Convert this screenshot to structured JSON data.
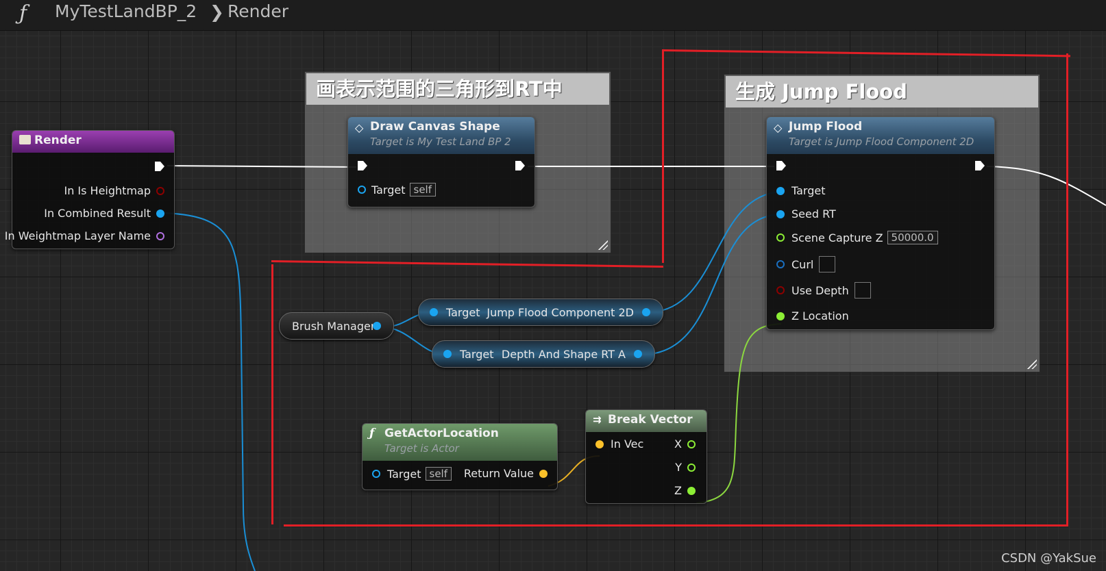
{
  "breadcrumb": {
    "function_icon": "ƒ",
    "blueprint": "MyTestLandBP_2",
    "separator": "❯",
    "graph": "Render"
  },
  "comments": {
    "draw": {
      "title": "画表示范围的三角形到RT中"
    },
    "jump": {
      "title": "生成 Jump Flood"
    }
  },
  "nodes": {
    "render": {
      "title": "Render",
      "pins": {
        "heightmap": "In Is Heightmap",
        "combined": "In Combined Result",
        "weightmap": "In Weightmap Layer Name"
      }
    },
    "draw_canvas": {
      "title": "Draw Canvas Shape",
      "subtitle": "Target is My Test Land BP 2",
      "target": "Target",
      "self": "self"
    },
    "jump_flood": {
      "title": "Jump Flood",
      "subtitle": "Target is Jump Flood Component 2D",
      "pins": {
        "target": "Target",
        "seed": "Seed RT",
        "scene": "Scene Capture Z",
        "scene_value": "50000.0",
        "curl": "Curl",
        "use_depth": "Use Depth",
        "zloc": "Z Location"
      }
    },
    "brush_manager": {
      "label": "Brush Manager"
    },
    "get_jfc": {
      "target": "Target",
      "output": "Jump Flood Component 2D"
    },
    "get_depth": {
      "target": "Target",
      "output": "Depth And Shape RT A"
    },
    "get_actor_location": {
      "title": "GetActorLocation",
      "subtitle": "Target is Actor",
      "target": "Target",
      "self": "self",
      "return": "Return Value"
    },
    "break_vector": {
      "title": "Break Vector",
      "in": "In Vec",
      "x": "X",
      "y": "Y",
      "z": "Z"
    }
  },
  "colors": {
    "exec": "#ffffff",
    "object": "#00a8f4",
    "bool": "#8c0000",
    "name": "#b070e0",
    "float": "#8cee35",
    "vector": "#fcc12a",
    "annotation": "#e21f26"
  },
  "watermark": "CSDN @YakSue"
}
